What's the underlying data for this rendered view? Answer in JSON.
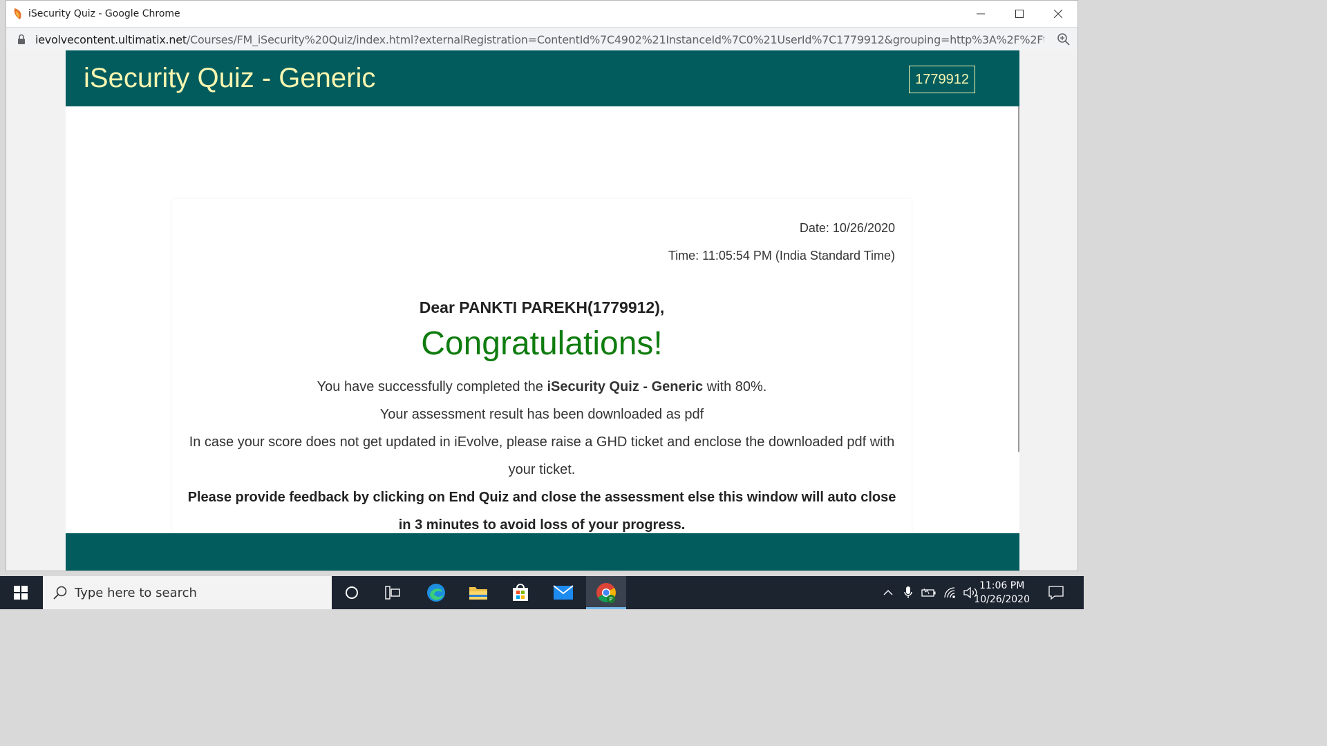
{
  "browser": {
    "window_title": "iSecurity Quiz - Google Chrome",
    "url_domain": "ievolvecontent.ultimatix.net",
    "url_path": "/Courses/FM_iSecurity%20Quiz/index.html?externalRegistration=ContentId%7C4902%21InstanceId%7C0%21UserId%7C1779912&grouping=http%3A%2F%2Ftinca..."
  },
  "quiz": {
    "title": "iSecurity Quiz - Generic",
    "user_id": "1779912",
    "date": "Date: 10/26/2020",
    "time": "Time: 11:05:54 PM (India Standard Time)",
    "greeting": "Dear PANKTI PAREKH(1779912),",
    "congrats": "Congratulations!",
    "completed_prefix": "You have successfully completed the ",
    "quiz_name": "iSecurity Quiz - Generic",
    "completed_suffix": " with 80%.",
    "downloaded": "Your assessment result has been downloaded as pdf",
    "ghd_notice": "In case your score does not get updated in iEvolve, please raise a GHD ticket and enclose the downloaded pdf with your ticket.",
    "feedback_notice": "Please provide feedback by clicking on End Quiz and close the assessment else this window will auto close in 3 minutes to avoid loss of your progress."
  },
  "taskbar": {
    "search_placeholder": "Type here to search",
    "time": "11:06 PM",
    "date": "10/26/2020"
  },
  "colors": {
    "header_bg": "#025c5e",
    "header_text": "#f8f6b0",
    "congrats_green": "#0f7c0f"
  }
}
